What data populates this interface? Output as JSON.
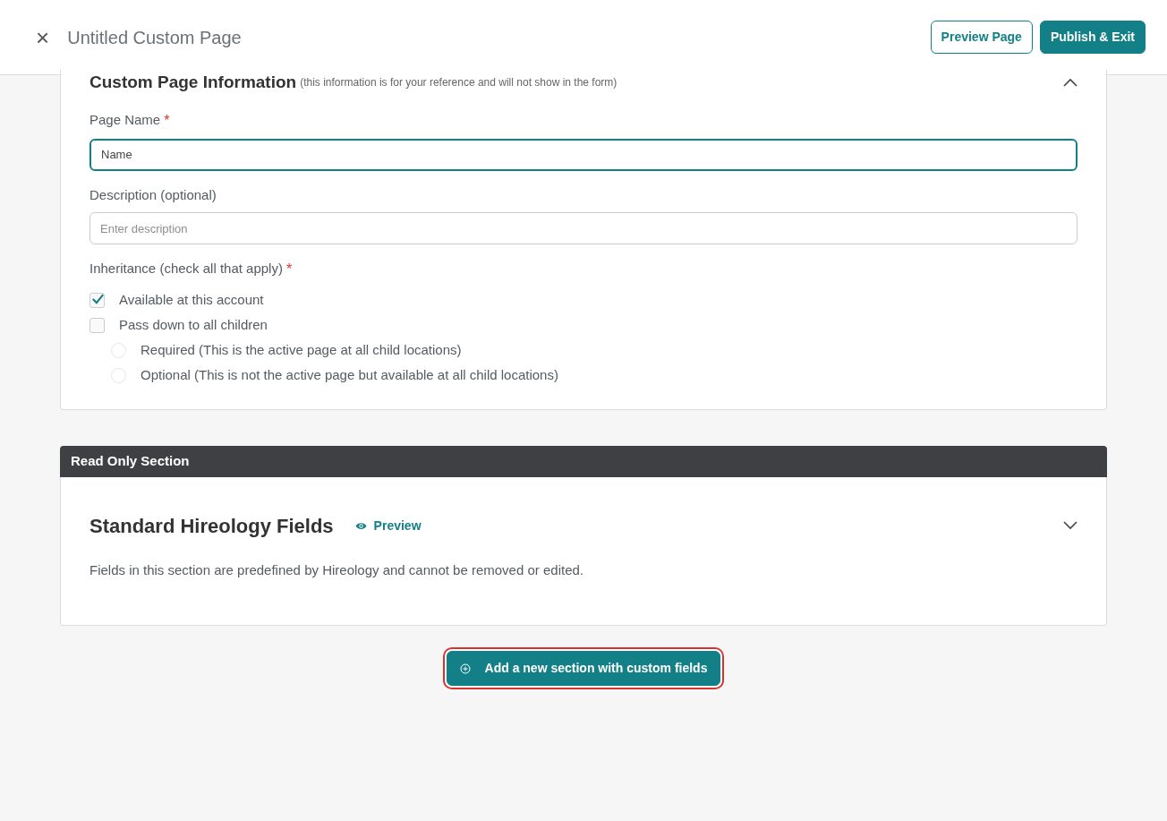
{
  "header": {
    "close": "×",
    "title": "Untitled Custom Page",
    "buttons": [
      {
        "label": "Preview Page",
        "kind": "outline"
      },
      {
        "label": "Publish & Exit",
        "kind": "solid"
      }
    ]
  },
  "info_card": {
    "title": "Custom Page Information",
    "note": "(this information is for your reference and will not show in the form)",
    "expanded": true,
    "fields": [
      {
        "label": "Page Name",
        "required_mark": "*",
        "value": "Name",
        "focused": true
      },
      {
        "label": "Description (optional)",
        "placeholder": "Enter description",
        "focused": false
      }
    ],
    "inheritance": {
      "label": "Inheritance (check all that apply)",
      "required_mark": "*",
      "checkboxes": [
        {
          "label": "Available at this account",
          "checked": true
        },
        {
          "label": "Pass down to all children",
          "checked": false
        }
      ],
      "radios": [
        {
          "label": "Required (This is the active page at all child locations)",
          "selected": false
        },
        {
          "label": "Optional (This is not the active page but available at all child locations)",
          "selected": false
        }
      ]
    }
  },
  "read_only": {
    "band": "Read Only Section",
    "title": "Standard Hireology Fields",
    "preview_link": "Preview",
    "expanded": false,
    "description": "Fields in this section are predefined by Hireology and cannot be removed or edited."
  },
  "add_button": {
    "label": "Add a new section with custom fields",
    "focused": true
  }
}
